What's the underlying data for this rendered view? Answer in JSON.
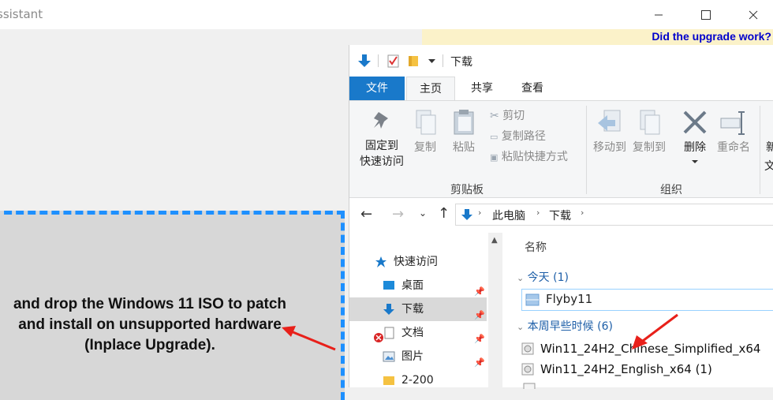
{
  "app": {
    "window_title_partial": "ssistant",
    "upgrade_link": "Did the upgrade work?",
    "drop_text_lines": [
      "and drop the Windows 11 ISO to patch",
      "and install on unsupported hardware",
      "(Inplace Upgrade)."
    ],
    "window_controls": [
      "minimize-icon",
      "maximize-icon",
      "close-icon"
    ]
  },
  "explorer": {
    "title": "下载",
    "tabs": {
      "file": "文件",
      "home": "主页",
      "share": "共享",
      "view": "查看"
    },
    "ribbon": {
      "pin_line1": "固定到",
      "pin_line2": "快速访问",
      "copy": "复制",
      "paste": "粘贴",
      "cut": "剪切",
      "copy_path": "复制路径",
      "paste_shortcut": "粘贴快捷方式",
      "clipboard_group": "剪贴板",
      "move_to": "移动到",
      "copy_to": "复制到",
      "delete": "删除",
      "rename": "重命名",
      "new_partial": "新",
      "new_partial2": "文",
      "organize_group": "组织"
    },
    "address": {
      "root": "此电脑",
      "sep": "›",
      "folder": "下载"
    },
    "nav": [
      {
        "label": "快速访问",
        "icon": "star-icon",
        "pinned": false
      },
      {
        "label": "桌面",
        "icon": "desktop-icon",
        "pinned": true
      },
      {
        "label": "下载",
        "icon": "download-icon",
        "pinned": true,
        "selected": true
      },
      {
        "label": "文档",
        "icon": "document-icon",
        "pinned": true
      },
      {
        "label": "图片",
        "icon": "picture-icon",
        "pinned": true
      },
      {
        "label": "2-200",
        "icon": "folder-icon",
        "pinned": false
      }
    ],
    "column_name": "名称",
    "groups": [
      {
        "header": "今天 (1)",
        "files": [
          "Flyby11"
        ]
      },
      {
        "header": "本周早些时候 (6)",
        "files": [
          "Win11_24H2_Chinese_Simplified_x64",
          "Win11_24H2_English_x64 (1)"
        ]
      }
    ]
  },
  "colors": {
    "accent": "#1979ca",
    "dash": "#1e90ff",
    "arrow": "#e8201a",
    "link": "#0000cc"
  }
}
